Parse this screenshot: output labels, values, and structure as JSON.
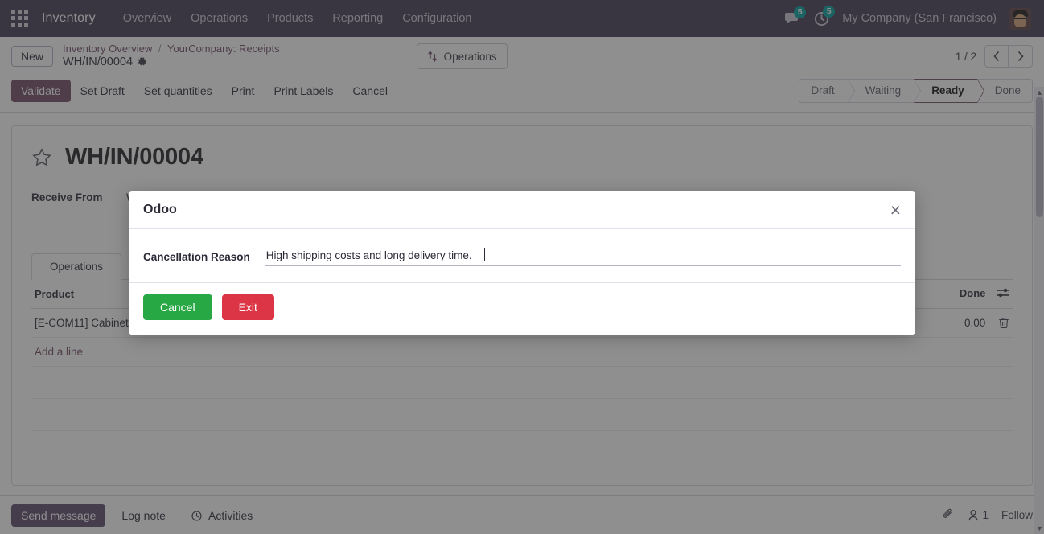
{
  "colors": {
    "navbar_bg": "#413a55",
    "primary": "#714b67",
    "badge": "#00a09d",
    "cancel_green": "#28a745",
    "exit_red": "#dc3545"
  },
  "navbar": {
    "apps_icon": "apps-grid-icon",
    "brand": "Inventory",
    "menus": [
      {
        "label": "Overview"
      },
      {
        "label": "Operations"
      },
      {
        "label": "Products"
      },
      {
        "label": "Reporting"
      },
      {
        "label": "Configuration"
      }
    ],
    "messages_icon": "chat-bubble-icon",
    "messages_count": "5",
    "activities_icon": "clock-icon",
    "activities_count": "5",
    "company": "My Company (San Francisco)",
    "avatar_icon": "user-avatar"
  },
  "control_panel": {
    "new_button": "New",
    "breadcrumb": {
      "root": "Inventory Overview",
      "separator": "/",
      "parent": "YourCompany: Receipts",
      "current": "WH/IN/00004",
      "settings_icon": "gear-icon"
    },
    "stat_button": {
      "label": "Operations",
      "icon": "arrows-up-down-icon"
    },
    "pager": {
      "count": "1 / 2",
      "prev_icon": "chevron-left-icon",
      "next_icon": "chevron-right-icon"
    },
    "actions": [
      {
        "label": "Validate",
        "style": "primary"
      },
      {
        "label": "Set Draft",
        "style": "secondary"
      },
      {
        "label": "Set quantities",
        "style": "secondary"
      },
      {
        "label": "Print",
        "style": "secondary"
      },
      {
        "label": "Print Labels",
        "style": "secondary"
      },
      {
        "label": "Cancel",
        "style": "secondary"
      }
    ],
    "statusbar": [
      {
        "label": "Draft",
        "active": false
      },
      {
        "label": "Waiting",
        "active": false
      },
      {
        "label": "Ready",
        "active": true
      },
      {
        "label": "Done",
        "active": false
      }
    ]
  },
  "record": {
    "favorite_icon": "star-icon",
    "title": "WH/IN/00004",
    "receive_from_label": "Receive From",
    "receive_from_value": "W",
    "tabs": [
      {
        "label": "Operations",
        "active": true
      }
    ],
    "lines": {
      "columns": [
        {
          "label": "Product",
          "align": "left"
        },
        {
          "label": "Done",
          "align": "right",
          "icon": "optional-columns-icon"
        }
      ],
      "rows": [
        {
          "product": "[E-COM11] Cabinet",
          "done": "0.00",
          "delete_icon": "trash-icon"
        }
      ],
      "add_line": "Add a line"
    }
  },
  "chatter": {
    "send_message": "Send message",
    "log_note": "Log note",
    "activities": "Activities",
    "activities_icon": "clock-icon",
    "attachment_icon": "paperclip-icon",
    "followers_icon": "person-icon",
    "followers_count": "1",
    "follow": "Follow"
  },
  "modal": {
    "title": "Odoo",
    "close_icon": "close-icon",
    "field_label": "Cancellation Reason",
    "field_value": "High shipping costs and long delivery time.",
    "field_placeholder": "",
    "buttons": [
      {
        "label": "Cancel",
        "style": "green"
      },
      {
        "label": "Exit",
        "style": "red"
      }
    ]
  }
}
